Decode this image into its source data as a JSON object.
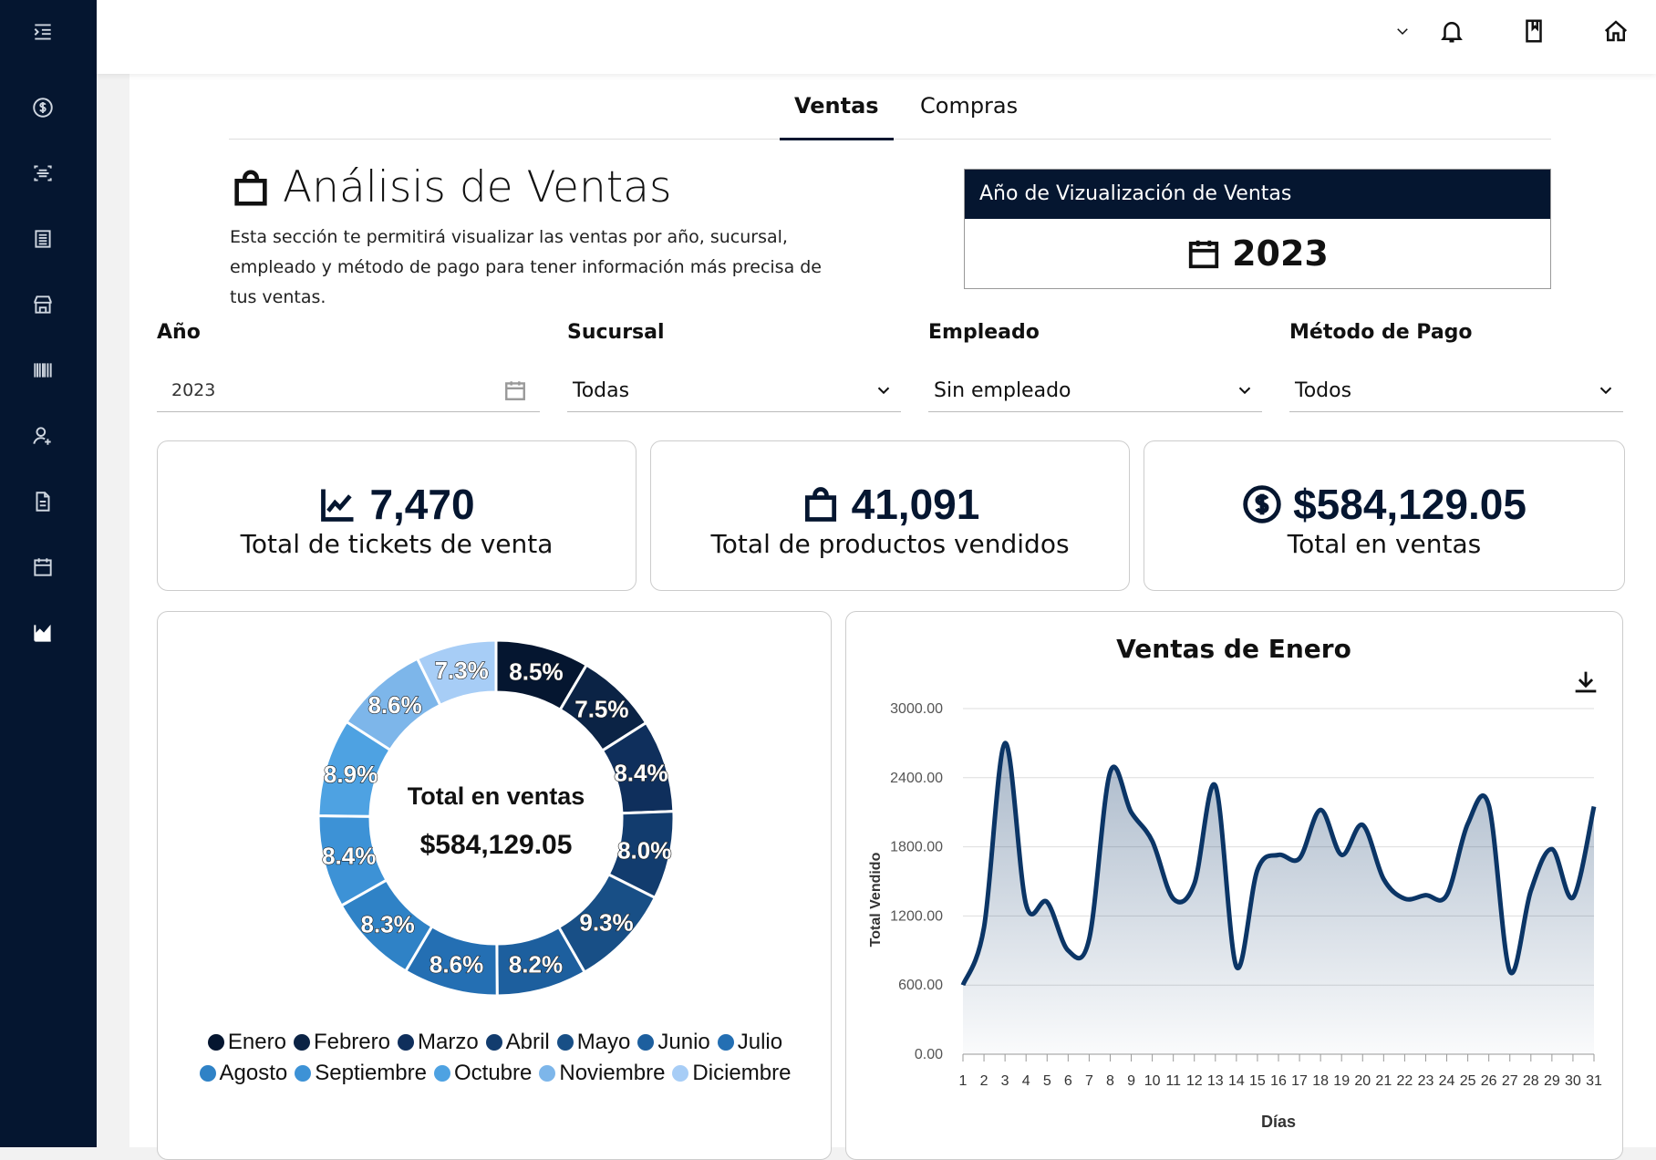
{
  "tabs": [
    {
      "label": "Ventas",
      "active": true
    },
    {
      "label": "Compras",
      "active": false
    }
  ],
  "header": {
    "title": "Análisis de Ventas",
    "description": "Esta sección te permitirá visualizar las ventas por año, sucursal, empleado y método de pago para tener información más precisa de tus ventas."
  },
  "year_display": {
    "heading": "Año de Vizualización de Ventas",
    "value": "2023"
  },
  "filters": {
    "year": {
      "label": "Año",
      "value": "2023"
    },
    "branch": {
      "label": "Sucursal",
      "value": "Todas"
    },
    "employee": {
      "label": "Empleado",
      "value": "Sin empleado"
    },
    "payment": {
      "label": "Método de Pago",
      "value": "Todos"
    }
  },
  "stats": [
    {
      "value": "7,470",
      "label": "Total de tickets de venta",
      "icon": "line-chart-icon"
    },
    {
      "value": "41,091",
      "label": "Total de productos vendidos",
      "icon": "shopping-bag-icon"
    },
    {
      "value": "$584,129.05",
      "label": "Total en ventas",
      "icon": "dollar-circle-icon"
    }
  ],
  "donut": {
    "center_title": "Total en ventas",
    "center_value": "$584,129.05"
  },
  "colors": {
    "sidebar": "#051630",
    "line": "#0b3566"
  },
  "chart_data": [
    {
      "type": "pie",
      "variant": "donut",
      "categories": [
        "Enero",
        "Febrero",
        "Marzo",
        "Abril",
        "Mayo",
        "Junio",
        "Julio",
        "Agosto",
        "Septiembre",
        "Octubre",
        "Noviembre",
        "Diciembre"
      ],
      "values": [
        8.5,
        7.5,
        8.4,
        8.0,
        9.3,
        8.2,
        8.6,
        8.3,
        8.4,
        8.9,
        8.6,
        7.3
      ],
      "labels": [
        "8.5%",
        "7.5%",
        "8.4%",
        "8.0%",
        "9.3%",
        "8.2%",
        "8.6%",
        "8.3%",
        "8.4%",
        "8.9%",
        "8.6%",
        "7.3%"
      ],
      "colors": [
        "#051630",
        "#0b2345",
        "#0f2f5c",
        "#123c6e",
        "#184f86",
        "#1d5f9e",
        "#246fb3",
        "#2f82c6",
        "#3d92d6",
        "#4ea2e2",
        "#7db6ea",
        "#a7cdf6"
      ],
      "legend_position": "bottom"
    },
    {
      "type": "area",
      "title": "Ventas de Enero",
      "xlabel": "Días",
      "ylabel": "Total Vendido",
      "x": [
        1,
        2,
        3,
        4,
        5,
        6,
        7,
        8,
        9,
        10,
        11,
        12,
        13,
        14,
        15,
        16,
        17,
        18,
        19,
        20,
        21,
        22,
        23,
        24,
        25,
        26,
        27,
        28,
        29,
        30,
        31
      ],
      "y": [
        600,
        1100,
        2700,
        1300,
        1320,
        900,
        1000,
        2450,
        2100,
        1850,
        1350,
        1480,
        2330,
        760,
        1600,
        1730,
        1700,
        2120,
        1730,
        1990,
        1520,
        1350,
        1380,
        1380,
        2000,
        2160,
        720,
        1420,
        1780,
        1360,
        2150
      ],
      "ylim": [
        0,
        3000
      ],
      "yticks": [
        "3000.00",
        "2400.00",
        "1800.00",
        "1200.00",
        "600.00",
        "0.00"
      ],
      "grid": true
    }
  ]
}
